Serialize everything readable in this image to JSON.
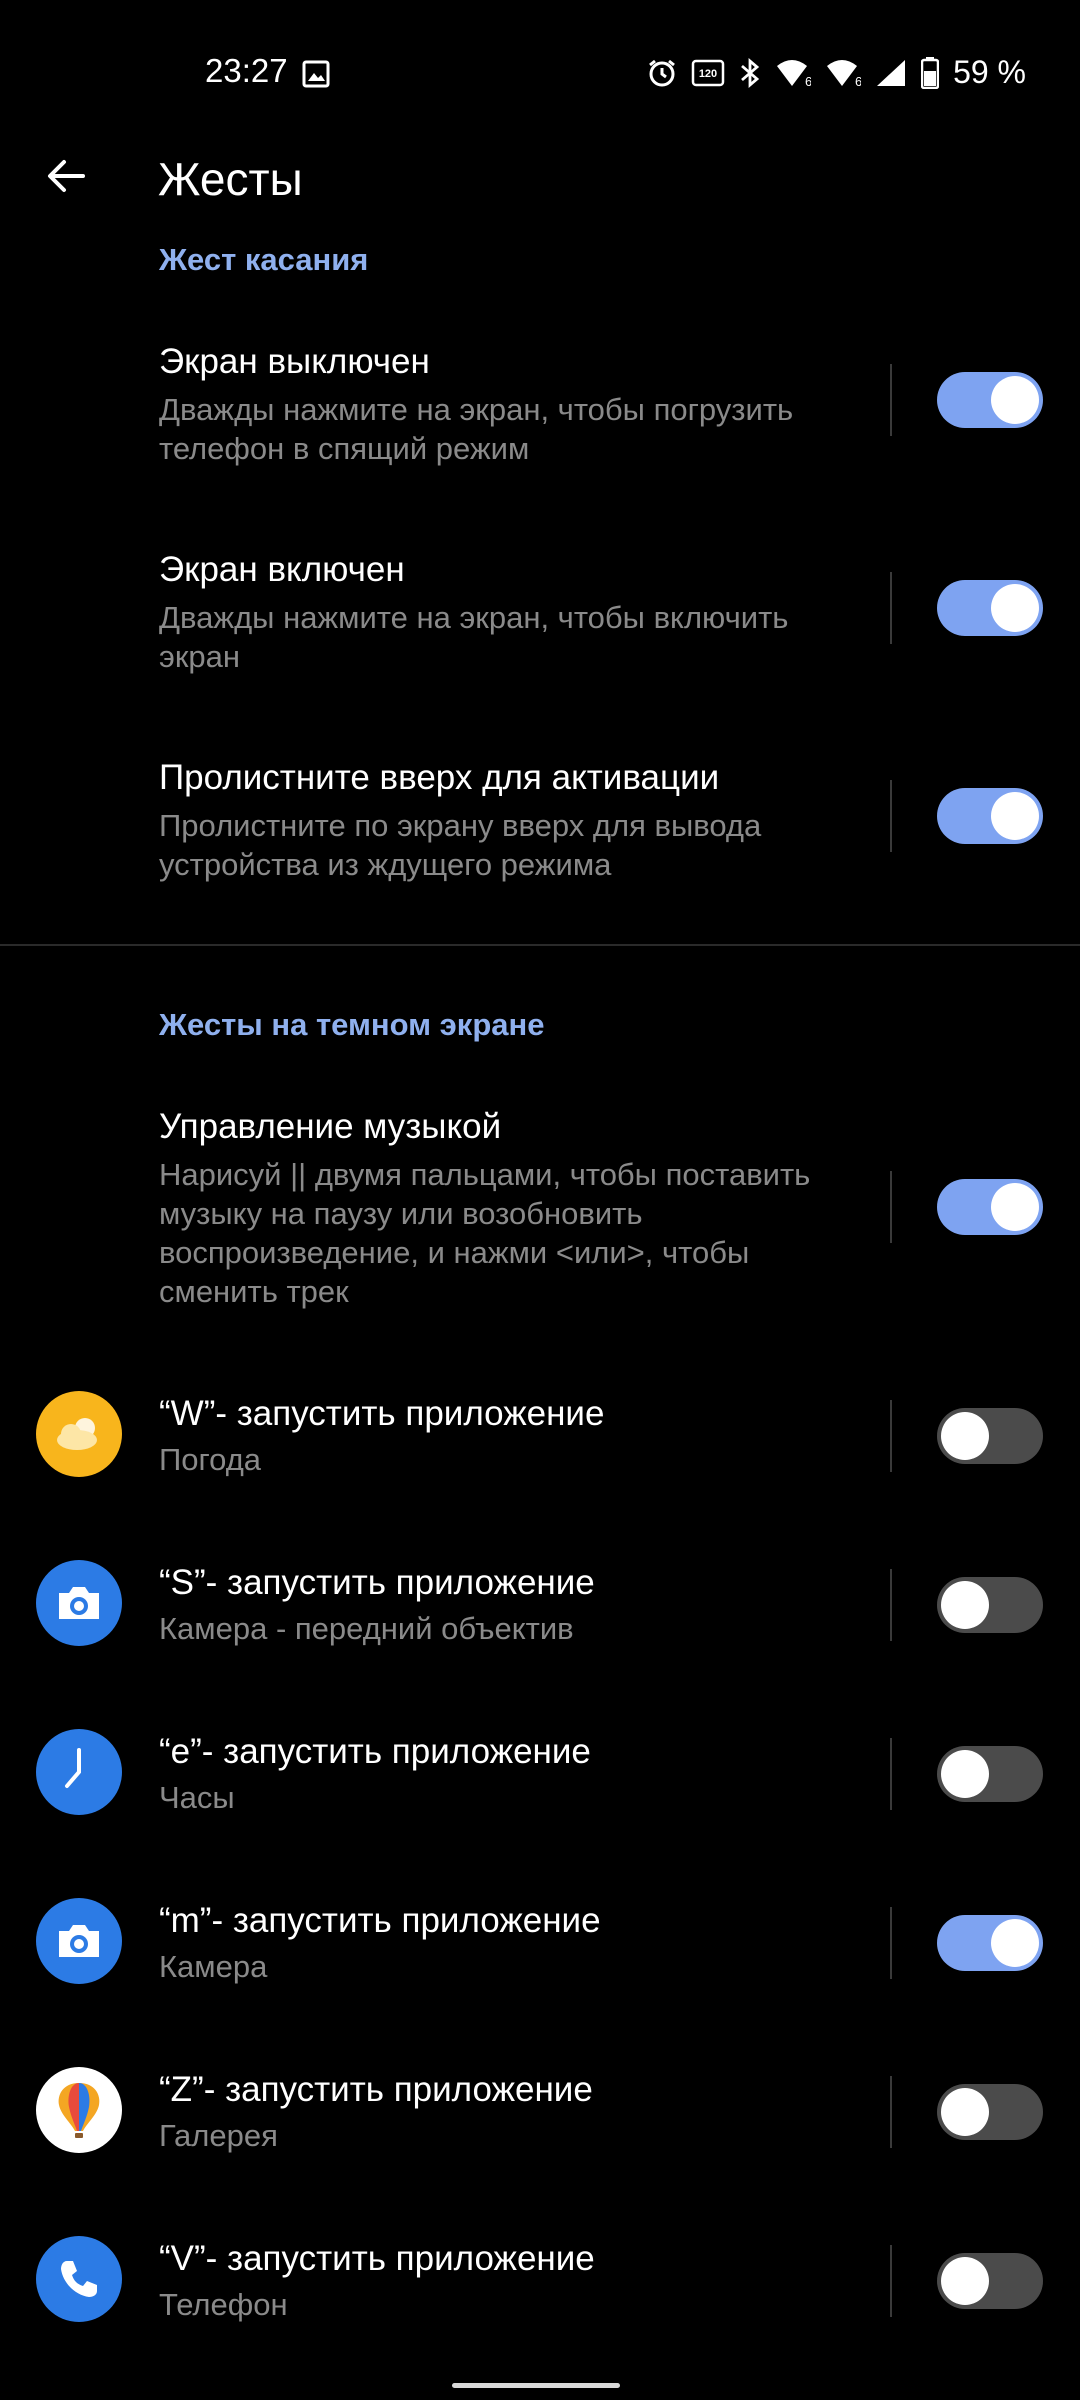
{
  "status_bar": {
    "time": "23:27",
    "battery": "59 %",
    "icons": [
      "image-icon",
      "alarm-icon",
      "120hz-icon",
      "bluetooth-icon",
      "wifi6-icon",
      "wifi6-icon",
      "signal-icon",
      "battery-icon"
    ]
  },
  "header": {
    "back_icon": "arrow-left-icon",
    "title": "Жесты"
  },
  "sections": {
    "tap_gesture": "Жест касания",
    "dark_screen": "Жесты на темном экране"
  },
  "tap_items": [
    {
      "title": "Экран выключен",
      "subtitle": "Дважды нажмите на экран, чтобы погрузить телефон в спящий режим",
      "enabled": true
    },
    {
      "title": "Экран включен",
      "subtitle": "Дважды нажмите на экран, чтобы включить экран",
      "enabled": true
    },
    {
      "title": "Пролистните вверх для активации",
      "subtitle": "Пролистните по экрану вверх для вывода устройства из ждущего режима",
      "enabled": true
    }
  ],
  "music_item": {
    "title": "Управление музыкой",
    "subtitle": "Нарисуй || двумя пальцами, чтобы поставить музыку на паузу или возобновить воспроизведение, и нажми <или>, чтобы сменить трек",
    "enabled": true
  },
  "letter_items": [
    {
      "title": "“W”- запустить приложение",
      "subtitle": "Погода",
      "icon": "weather-icon",
      "enabled": false
    },
    {
      "title": "“S”- запустить приложение",
      "subtitle": "Камера - передний объектив",
      "icon": "camera-icon",
      "enabled": false
    },
    {
      "title": "“e”- запустить приложение",
      "subtitle": "Часы",
      "icon": "clock-icon",
      "enabled": false
    },
    {
      "title": "“m”- запустить приложение",
      "subtitle": "Камера",
      "icon": "camera-icon",
      "enabled": true
    },
    {
      "title": "“Z”- запустить приложение",
      "subtitle": "Галерея",
      "icon": "gallery-icon",
      "enabled": false
    },
    {
      "title": "“V”- запустить приложение",
      "subtitle": "Телефон",
      "icon": "phone-icon",
      "enabled": false
    }
  ],
  "colors": {
    "accent": "#8fb0ee",
    "toggle_on": "#7ea3f1",
    "toggle_off": "#4b4b4b",
    "background": "#000000"
  }
}
